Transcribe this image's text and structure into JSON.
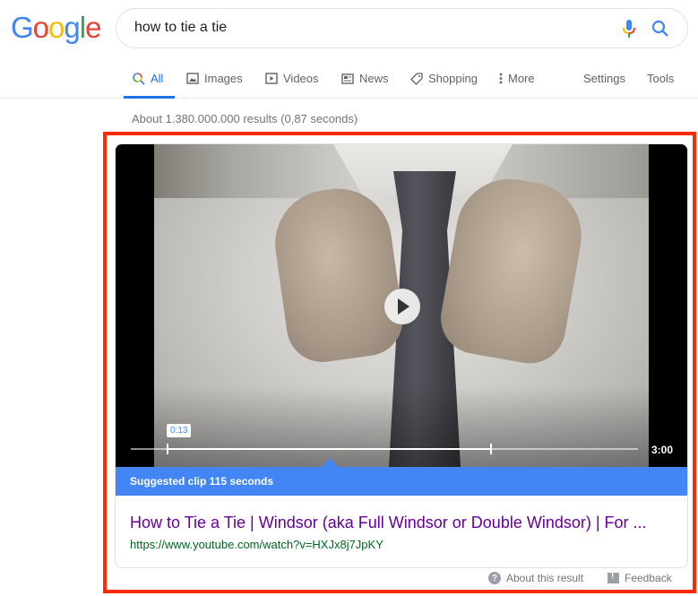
{
  "logo": {
    "letters": [
      {
        "char": "G",
        "color": "#4285f4"
      },
      {
        "char": "o",
        "color": "#ea4335"
      },
      {
        "char": "o",
        "color": "#fbbc05"
      },
      {
        "char": "g",
        "color": "#4285f4"
      },
      {
        "char": "l",
        "color": "#34a853"
      },
      {
        "char": "e",
        "color": "#ea4335"
      }
    ]
  },
  "search": {
    "query": "how to tie a tie",
    "mic_icon": "microphone-icon",
    "search_icon": "magnifier-icon"
  },
  "tabs": [
    {
      "label": "All",
      "icon": "search-icon",
      "active": true
    },
    {
      "label": "Images",
      "icon": "image-icon",
      "active": false
    },
    {
      "label": "Videos",
      "icon": "play-icon",
      "active": false
    },
    {
      "label": "News",
      "icon": "newspaper-icon",
      "active": false
    },
    {
      "label": "Shopping",
      "icon": "tag-icon",
      "active": false
    },
    {
      "label": "More",
      "icon": "kebab-icon",
      "active": false
    }
  ],
  "tools": {
    "settings": "Settings",
    "tools": "Tools"
  },
  "result_stats": "About 1.380.000.000 results (0,87 seconds)",
  "video_result": {
    "clip_start_label": "0:13",
    "duration": "3:00",
    "clip_start_fraction": 0.072,
    "clip_end_fraction": 0.711,
    "suggested_clip": "Suggested clip 115 seconds",
    "title": "How to Tie a Tie | Windsor (aka Full Windsor or Double Windsor) | For ...",
    "url": "https://www.youtube.com/watch?v=HXJx8j7JpKY"
  },
  "footer": {
    "about": "About this result",
    "feedback": "Feedback"
  },
  "colors": {
    "highlight": "#ff2a00",
    "accent_blue": "#4285f4",
    "visited_link": "#660099",
    "url_green": "#006621"
  }
}
